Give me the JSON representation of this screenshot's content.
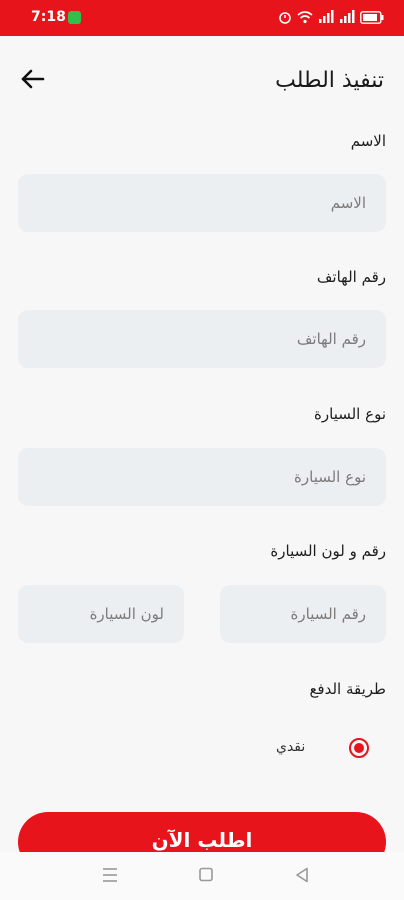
{
  "status_bar": {
    "time": "7:18"
  },
  "header": {
    "title": "تنفيذ الطلب"
  },
  "form": {
    "name": {
      "label": "الاسم",
      "placeholder": "الاسم",
      "value": ""
    },
    "phone": {
      "label": "رقم الهاتف",
      "placeholder": "رقم الهاتف",
      "value": ""
    },
    "car_type": {
      "label": "نوع السيارة",
      "placeholder": "نوع السيارة",
      "value": ""
    },
    "car_number_color": {
      "label": "رقم و لون السيارة",
      "car_number_placeholder": "رقم السيارة",
      "car_color_placeholder": "لون السيارة"
    },
    "payment": {
      "label": "طريقة الدفع",
      "option": "نقدي",
      "selected": true
    }
  },
  "submit_label": "اطلب الآن",
  "colors": {
    "accent": "#e8141c",
    "field_bg": "#eceff2",
    "page_bg": "#f7f7f8"
  },
  "icons": [
    "back-arrow-icon",
    "wifi-icon",
    "signal-icon",
    "battery-icon",
    "menu-nav-icon",
    "home-nav-icon",
    "back-nav-icon"
  ]
}
